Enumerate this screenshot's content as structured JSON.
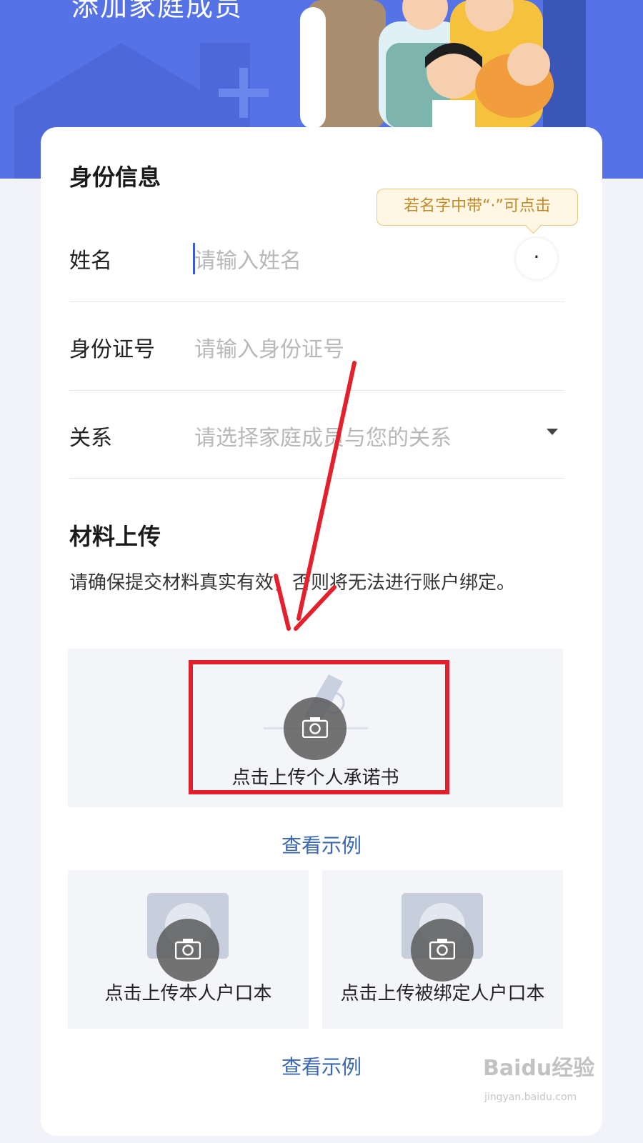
{
  "header": {
    "title": "添加家庭成员"
  },
  "identity": {
    "section_title": "身份信息",
    "tooltip": "若名字中带“·”可点击",
    "dot_button": "·",
    "fields": [
      {
        "label": "姓名",
        "placeholder": "请输入姓名"
      },
      {
        "label": "身份证号",
        "placeholder": "请输入身份证号"
      },
      {
        "label": "关系",
        "placeholder": "请选择家庭成员与您的关系"
      }
    ]
  },
  "materials": {
    "section_title": "材料上传",
    "description": "请确保提交材料真实有效，否则将无法进行账户绑定。",
    "uploads": [
      {
        "label": "点击上传个人承诺书"
      },
      {
        "label": "点击上传本人户口本"
      },
      {
        "label": "点击上传被绑定人户口本"
      }
    ],
    "example_links": [
      "查看示例",
      "查看示例"
    ]
  },
  "watermark": {
    "brand": "Baidu经验",
    "url": "jingyan.baidu.com"
  },
  "colors": {
    "header_bg": "#5572e6",
    "link": "#3a67b0",
    "highlight": "#e4202c",
    "cursor": "#3b5bdc"
  }
}
